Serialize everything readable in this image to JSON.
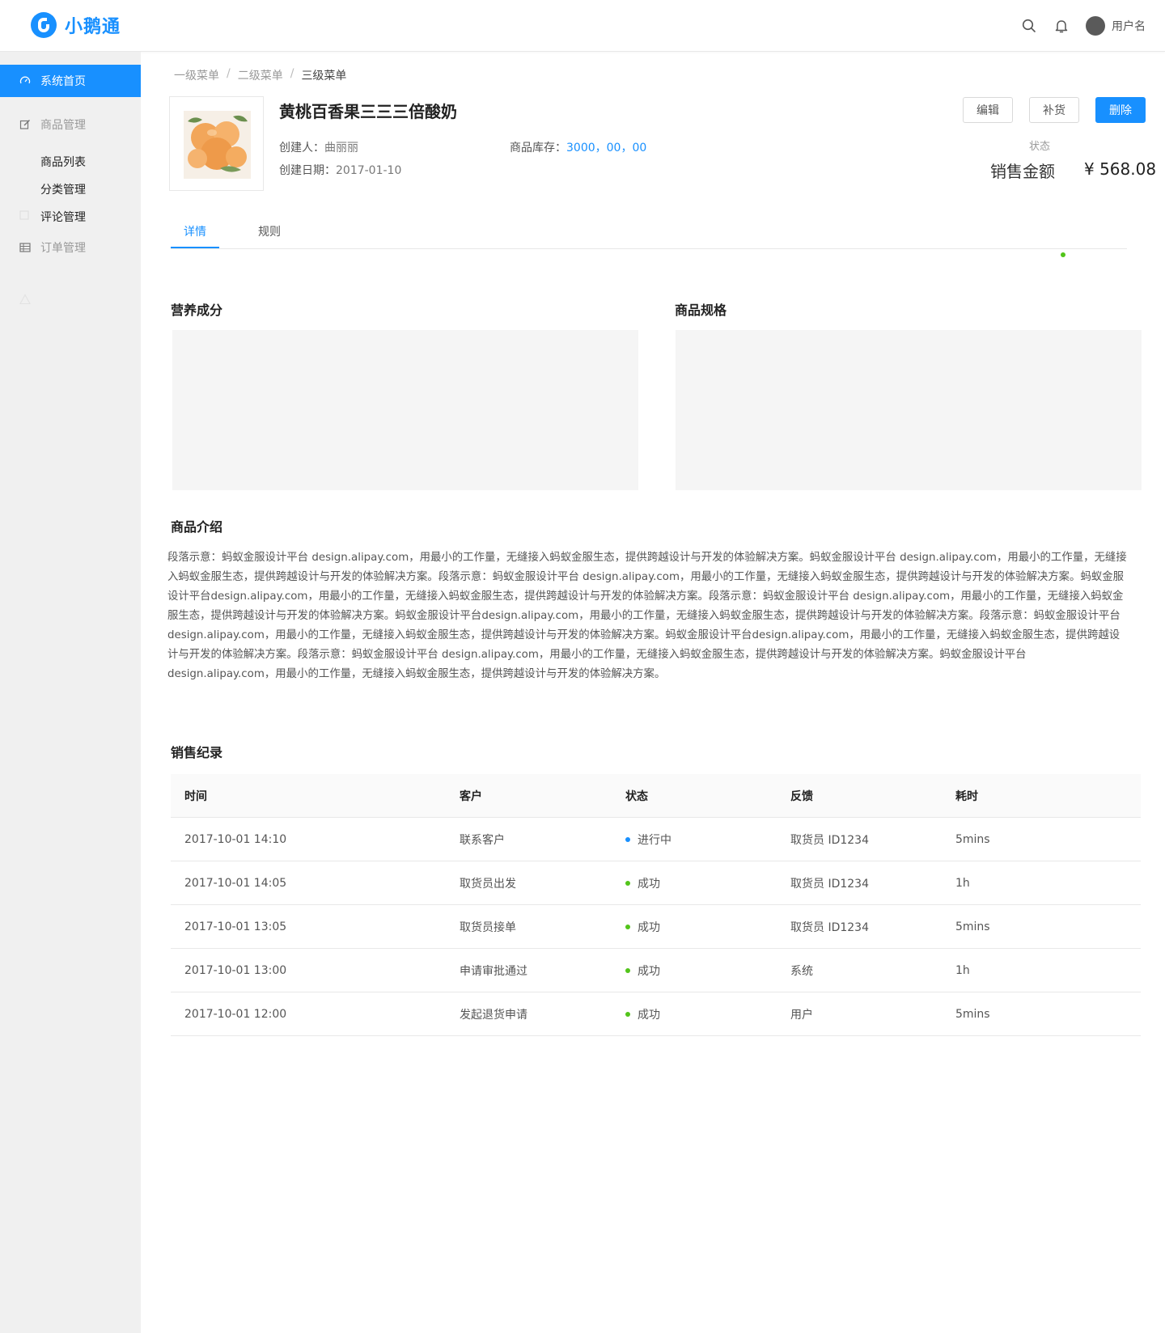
{
  "app": {
    "name": "小鹅通"
  },
  "header": {
    "user_name": "用户名"
  },
  "sidebar": {
    "items": [
      {
        "label": "系统首页",
        "icon": "dashboard-icon",
        "active": true
      },
      {
        "label": "商品管理",
        "icon": "edit-icon",
        "active": false
      },
      {
        "label": "订单管理",
        "icon": "table-icon",
        "active": false
      }
    ],
    "sub_items": [
      "商品列表",
      "分类管理",
      "评论管理"
    ]
  },
  "breadcrumb": [
    "一级菜单",
    "二级菜单",
    "三级菜单"
  ],
  "product": {
    "title": "黄桃百香果三三三倍酸奶",
    "creator_label": "创建人：",
    "creator": "曲丽丽",
    "date_label": "创建日期：",
    "date": "2017-01-10",
    "stock_label": "商品库存：",
    "stock": "3000，00，00",
    "status_label": "状态",
    "sales_label": "销售金额",
    "sales_value": "¥ 568.08"
  },
  "actions": {
    "edit": "编辑",
    "restock": "补货",
    "delete": "删除"
  },
  "tabs": [
    {
      "label": "详情",
      "active": true
    },
    {
      "label": "规则",
      "active": false
    }
  ],
  "sections": {
    "nutrition": "营养成分",
    "spec": "商品规格",
    "intro_title": "商品介绍",
    "intro_text": "段落示意：蚂蚁金服设计平台 design.alipay.com，用最小的工作量，无缝接入蚂蚁金服生态，提供跨越设计与开发的体验解决方案。蚂蚁金服设计平台 design.alipay.com，用最小的工作量，无缝接入蚂蚁金服生态，提供跨越设计与开发的体验解决方案。段落示意：蚂蚁金服设计平台 design.alipay.com，用最小的工作量，无缝接入蚂蚁金服生态，提供跨越设计与开发的体验解决方案。蚂蚁金服设计平台design.alipay.com，用最小的工作量，无缝接入蚂蚁金服生态，提供跨越设计与开发的体验解决方案。段落示意：蚂蚁金服设计平台 design.alipay.com，用最小的工作量，无缝接入蚂蚁金服生态，提供跨越设计与开发的体验解决方案。蚂蚁金服设计平台design.alipay.com，用最小的工作量，无缝接入蚂蚁金服生态，提供跨越设计与开发的体验解决方案。段落示意：蚂蚁金服设计平台 design.alipay.com，用最小的工作量，无缝接入蚂蚁金服生态，提供跨越设计与开发的体验解决方案。蚂蚁金服设计平台design.alipay.com，用最小的工作量，无缝接入蚂蚁金服生态，提供跨越设计与开发的体验解决方案。段落示意：蚂蚁金服设计平台 design.alipay.com，用最小的工作量，无缝接入蚂蚁金服生态，提供跨越设计与开发的体验解决方案。蚂蚁金服设计平台design.alipay.com，用最小的工作量，无缝接入蚂蚁金服生态，提供跨越设计与开发的体验解决方案。",
    "sales_title": "销售纪录"
  },
  "table": {
    "columns": [
      "时间",
      "客户",
      "状态",
      "反馈",
      "耗时"
    ],
    "rows": [
      {
        "time": "2017-10-01  14:10",
        "customer": "联系客户",
        "status": "进行中",
        "feedback": "取货员 ID1234",
        "duration": "5mins"
      },
      {
        "time": "2017-10-01  14:05",
        "customer": "取货员出发",
        "status": "成功",
        "feedback": "取货员 ID1234",
        "duration": "1h"
      },
      {
        "time": "2017-10-01  13:05",
        "customer": "取货员接单",
        "status": "成功",
        "feedback": "取货员 ID1234",
        "duration": "5mins"
      },
      {
        "time": "2017-10-01  13:00",
        "customer": "申请审批通过",
        "status": "成功",
        "feedback": "系统",
        "duration": "1h"
      },
      {
        "time": "2017-10-01  12:00",
        "customer": "发起退货申请",
        "status": "成功",
        "feedback": "用户",
        "duration": "5mins"
      }
    ]
  },
  "colors": {
    "primary": "#1890ff",
    "success": "#52c41a",
    "processing": "#1890ff"
  }
}
